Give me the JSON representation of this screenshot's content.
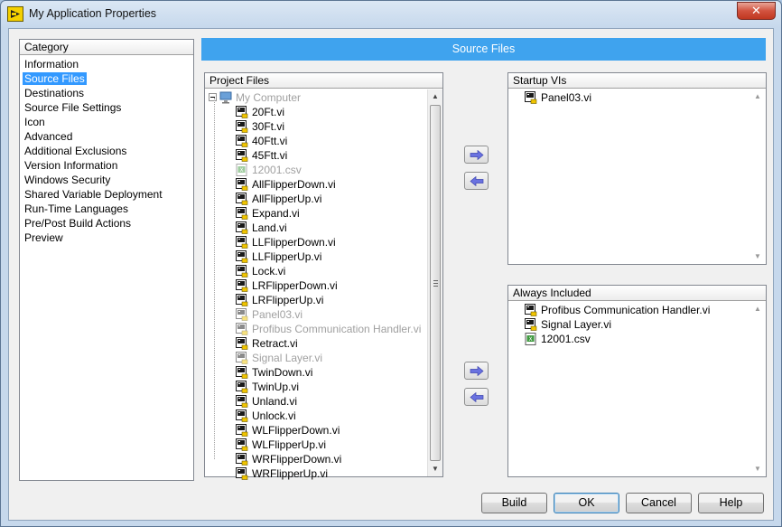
{
  "window": {
    "title": "My Application Properties",
    "close_label": "✕"
  },
  "category": {
    "header": "Category",
    "items": [
      "Information",
      "Source Files",
      "Destinations",
      "Source File Settings",
      "Icon",
      "Advanced",
      "Additional Exclusions",
      "Version Information",
      "Windows Security",
      "Shared Variable Deployment",
      "Run-Time Languages",
      "Pre/Post Build Actions",
      "Preview"
    ],
    "selected": "Source Files"
  },
  "section_title": "Source Files",
  "project_files": {
    "header": "Project Files",
    "root": "My Computer",
    "items": [
      {
        "name": "20Ft.vi",
        "type": "vi",
        "greyed": false
      },
      {
        "name": "30Ft.vi",
        "type": "vi",
        "greyed": false
      },
      {
        "name": "40Ftt.vi",
        "type": "vi",
        "greyed": false
      },
      {
        "name": "45Ftt.vi",
        "type": "vi",
        "greyed": false
      },
      {
        "name": "12001.csv",
        "type": "csv",
        "greyed": true
      },
      {
        "name": "AllFlipperDown.vi",
        "type": "vi",
        "greyed": false
      },
      {
        "name": "AllFlipperUp.vi",
        "type": "vi",
        "greyed": false
      },
      {
        "name": "Expand.vi",
        "type": "vi",
        "greyed": false
      },
      {
        "name": "Land.vi",
        "type": "vi",
        "greyed": false
      },
      {
        "name": "LLFlipperDown.vi",
        "type": "vi",
        "greyed": false
      },
      {
        "name": "LLFlipperUp.vi",
        "type": "vi",
        "greyed": false
      },
      {
        "name": "Lock.vi",
        "type": "vi",
        "greyed": false
      },
      {
        "name": "LRFlipperDown.vi",
        "type": "vi",
        "greyed": false
      },
      {
        "name": "LRFlipperUp.vi",
        "type": "vi",
        "greyed": false
      },
      {
        "name": "Panel03.vi",
        "type": "vi",
        "greyed": true
      },
      {
        "name": "Profibus Communication Handler.vi",
        "type": "vi",
        "greyed": true
      },
      {
        "name": "Retract.vi",
        "type": "vi",
        "greyed": false
      },
      {
        "name": "Signal Layer.vi",
        "type": "vi",
        "greyed": true
      },
      {
        "name": "TwinDown.vi",
        "type": "vi",
        "greyed": false
      },
      {
        "name": "TwinUp.vi",
        "type": "vi",
        "greyed": false
      },
      {
        "name": "Unland.vi",
        "type": "vi",
        "greyed": false
      },
      {
        "name": "Unlock.vi",
        "type": "vi",
        "greyed": false
      },
      {
        "name": "WLFlipperDown.vi",
        "type": "vi",
        "greyed": false
      },
      {
        "name": "WLFlipperUp.vi",
        "type": "vi",
        "greyed": false
      },
      {
        "name": "WRFlipperDown.vi",
        "type": "vi",
        "greyed": false
      },
      {
        "name": "WRFlipperUp.vi",
        "type": "vi",
        "greyed": false
      }
    ]
  },
  "startup_vis": {
    "header": "Startup VIs",
    "items": [
      {
        "name": "Panel03.vi",
        "type": "vi"
      }
    ]
  },
  "always_included": {
    "header": "Always Included",
    "items": [
      {
        "name": "Profibus Communication Handler.vi",
        "type": "vi"
      },
      {
        "name": "Signal Layer.vi",
        "type": "vi"
      },
      {
        "name": "12001.csv",
        "type": "csv"
      }
    ]
  },
  "buttons": {
    "build": "Build",
    "ok": "OK",
    "cancel": "Cancel",
    "help": "Help"
  },
  "colors": {
    "accent": "#3fa3ee",
    "selection": "#3399ff",
    "arrow": "#6a72e0",
    "greyed_text": "#a0a0a0"
  }
}
